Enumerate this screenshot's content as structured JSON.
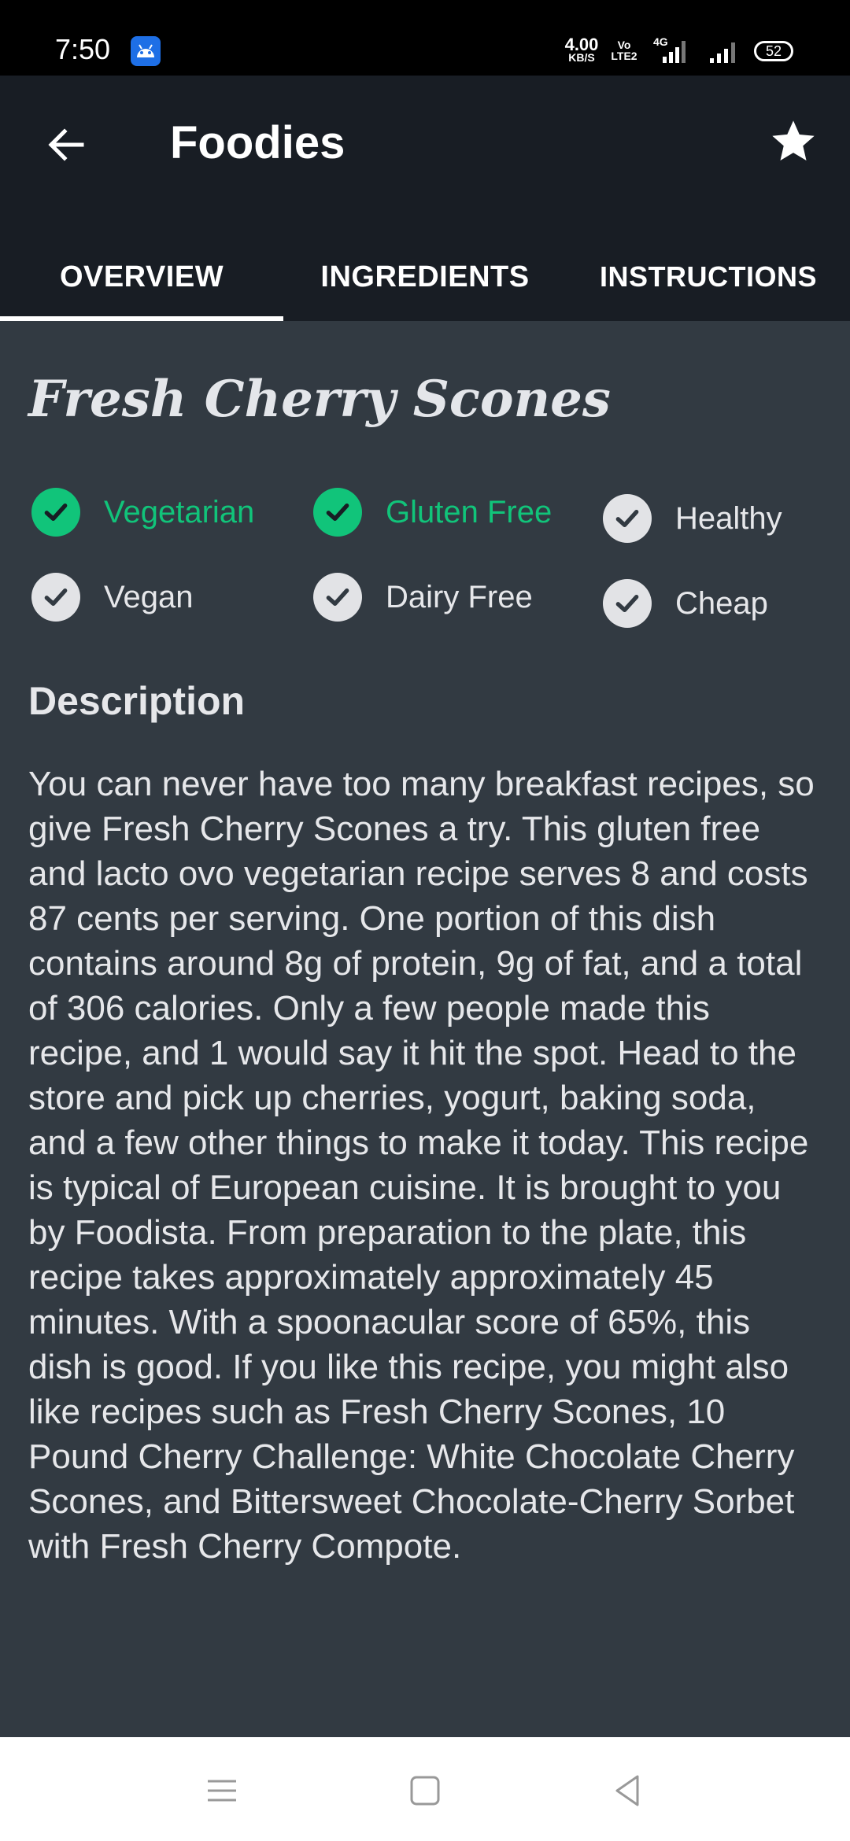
{
  "status_bar": {
    "time": "7:50",
    "network_speed": "4.00",
    "network_speed_unit": "KB/S",
    "volte": "Vo LTE2",
    "network_type": "4G",
    "battery": "52"
  },
  "app_bar": {
    "title": "Foodies",
    "back_icon": "arrow-left-icon",
    "favorite_icon": "star-icon"
  },
  "tabs": [
    {
      "label": "OVERVIEW",
      "selected": true
    },
    {
      "label": "INGREDIENTS",
      "selected": false
    },
    {
      "label": "INSTRUCTIONS",
      "selected": false
    }
  ],
  "recipe": {
    "title": "Fresh Cherry Scones",
    "tags": [
      {
        "label": "Vegetarian",
        "active": true
      },
      {
        "label": "Gluten Free",
        "active": true
      },
      {
        "label": "Healthy",
        "active": false
      },
      {
        "label": "Vegan",
        "active": false
      },
      {
        "label": "Dairy Free",
        "active": false
      },
      {
        "label": "Cheap",
        "active": false
      }
    ],
    "description_heading": "Description",
    "description": "You can never have too many breakfast recipes, so give Fresh Cherry Scones a try. This gluten free and lacto ovo vegetarian recipe serves 8 and costs 87 cents per serving. One portion of this dish contains around 8g of protein, 9g of fat, and a total of 306 calories. Only a few people made this recipe, and 1 would say it hit the spot. Head to the store and pick up cherries, yogurt, baking soda, and a few other things to make it today. This recipe is typical of European cuisine. It is brought to you by Foodista. From preparation to the plate, this recipe takes approximately approximately 45 minutes. With a spoonacular score of 65%, this dish is good. If you like this recipe, you might also like recipes such as Fresh Cherry Scones, 10 Pound Cherry Challenge: White Chocolate Cherry Scones, and Bittersweet Chocolate-Cherry Sorbet with Fresh Cherry Compote."
  },
  "colors": {
    "active_green": "#11c47a",
    "background": "#323a42",
    "app_bar": "#181d24"
  },
  "nav_bar": {
    "menu_icon": "menu-icon",
    "home_icon": "square-home-icon",
    "back_icon": "triangle-back-icon"
  }
}
